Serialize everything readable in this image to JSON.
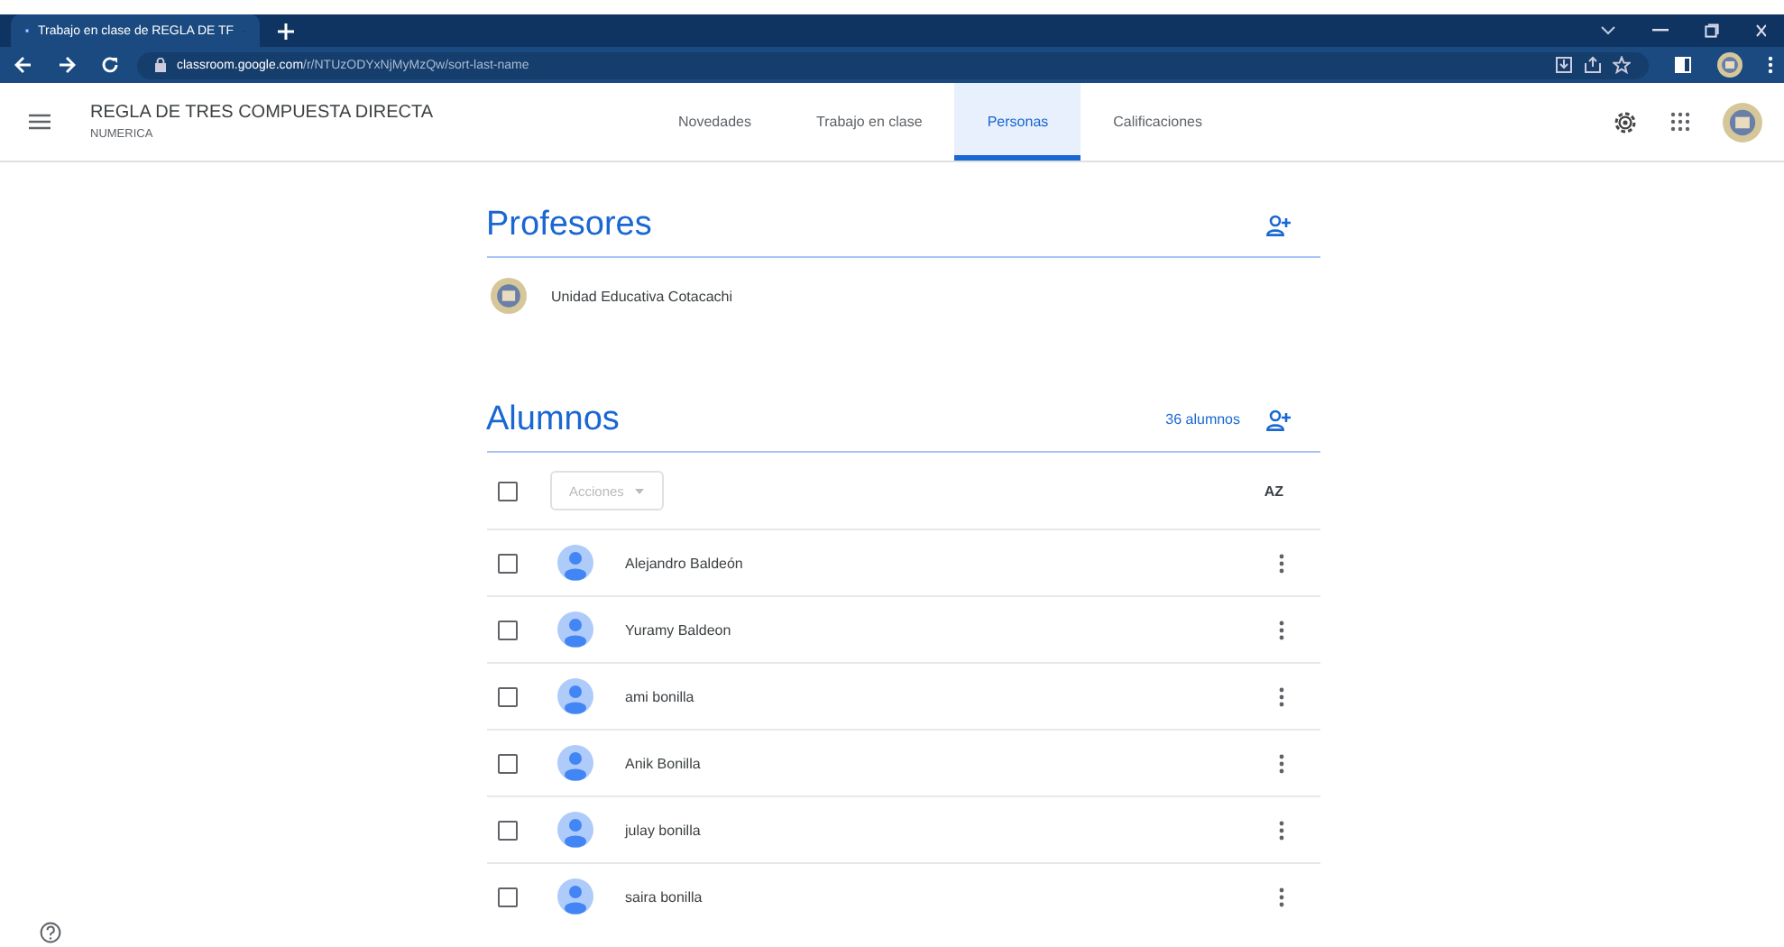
{
  "browser": {
    "tab_title": "Trabajo en clase de REGLA DE TF",
    "url_host": "classroom.google.com",
    "url_path": "/r/NTUzODYxNjMyMzQw/sort-last-name"
  },
  "header": {
    "class_name": "REGLA DE TRES COMPUESTA DIRECTA",
    "section": "NUMERICA",
    "tabs": [
      {
        "label": "Novedades",
        "selected": false
      },
      {
        "label": "Trabajo en clase",
        "selected": false
      },
      {
        "label": "Personas",
        "selected": true
      },
      {
        "label": "Calificaciones",
        "selected": false
      }
    ]
  },
  "teachers": {
    "title": "Profesores",
    "people": [
      {
        "name": "Unidad Educativa Cotacachi"
      }
    ]
  },
  "students": {
    "title": "Alumnos",
    "count": "36 alumnos",
    "actions": "Acciones",
    "sort_label": "AZ",
    "select_all_checked": false,
    "people": [
      {
        "name": "Alejandro Baldeón",
        "checked": false
      },
      {
        "name": "Yuramy Baldeon",
        "checked": false
      },
      {
        "name": "ami bonilla",
        "checked": false
      },
      {
        "name": "Anik Bonilla",
        "checked": false
      },
      {
        "name": "julay bonilla",
        "checked": false
      },
      {
        "name": "saira bonilla",
        "checked": false
      }
    ]
  }
}
